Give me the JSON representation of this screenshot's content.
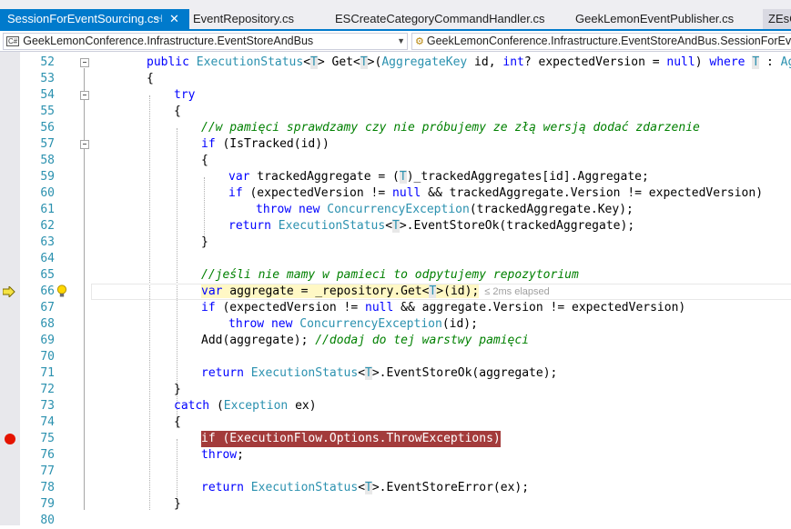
{
  "tabs": [
    {
      "label": "SessionForEventSourcing.cs",
      "active": true,
      "pin": "⊣",
      "close": "✕"
    },
    {
      "label": "EventRepository.cs"
    },
    {
      "label": "ESCreateCategoryCommandHandler.cs"
    },
    {
      "label": "GeekLemonEventPublisher.cs"
    },
    {
      "label": "ZEsC"
    }
  ],
  "navbar": {
    "left_badge": "C#",
    "left": "GeekLemonConference.Infrastructure.EventStoreAndBus",
    "right": "GeekLemonConference.Infrastructure.EventStoreAndBus.SessionForEventSo"
  },
  "execution": {
    "current_line": 66,
    "elapsed": "≤ 2ms elapsed",
    "breakpoint_line": 75
  },
  "colors": {
    "accent": "#007acc",
    "keyword": "#0000ff",
    "type": "#2b91af",
    "comment": "#008000",
    "breakpoint": "#e51400"
  },
  "lines": [
    {
      "n": "52"
    },
    {
      "n": "53"
    },
    {
      "n": "54"
    },
    {
      "n": "55"
    },
    {
      "n": "56"
    },
    {
      "n": "57"
    },
    {
      "n": "58"
    },
    {
      "n": "59"
    },
    {
      "n": "60"
    },
    {
      "n": "61"
    },
    {
      "n": "62"
    },
    {
      "n": "63"
    },
    {
      "n": "64"
    },
    {
      "n": "65"
    },
    {
      "n": "66"
    },
    {
      "n": "67"
    },
    {
      "n": "68"
    },
    {
      "n": "69"
    },
    {
      "n": "70"
    },
    {
      "n": "71"
    },
    {
      "n": "72"
    },
    {
      "n": "73"
    },
    {
      "n": "74"
    },
    {
      "n": "75"
    },
    {
      "n": "76"
    },
    {
      "n": "77"
    },
    {
      "n": "78"
    },
    {
      "n": "79"
    },
    {
      "n": "80"
    }
  ],
  "code": {
    "l52": {
      "a": "public ",
      "b": "ExecutionStatus",
      "c": "<",
      "d": "T",
      "e": "> Get<",
      "f": "T",
      "g": ">(",
      "h": "AggregateKey",
      "i": " id, ",
      "j": "int",
      "k": "? expectedVersion = ",
      "l": "null",
      "m": ") ",
      "n": "where",
      "o": " ",
      "p": "T",
      "q": " : ",
      "r": "Aggre"
    },
    "l53": "{",
    "l54": "try",
    "l55": "{",
    "l56": "//w pamięci sprawdzamy czy nie próbujemy ze złą wersją dodać zdarzenie",
    "l57": {
      "a": "if",
      "b": " (IsTracked(id))"
    },
    "l58": "{",
    "l59": {
      "a": "var",
      "b": " trackedAggregate = (",
      "c": "T",
      "d": ")_trackedAggregates[id].Aggregate;"
    },
    "l60": {
      "a": "if",
      "b": " (expectedVersion != ",
      "c": "null",
      "d": " && trackedAggregate.Version != expectedVersion)"
    },
    "l61": {
      "a": "throw",
      "b": " ",
      "c": "new",
      "d": " ",
      "e": "ConcurrencyException",
      "f": "(trackedAggregate.Key);"
    },
    "l62": {
      "a": "return",
      "b": " ",
      "c": "ExecutionStatus",
      "d": "<",
      "e": "T",
      "f": ">.EventStoreOk(trackedAggregate);"
    },
    "l63": "}",
    "l65": "//jeśli nie mamy w pamieci to odpytujemy repozytorium",
    "l66": {
      "a": "var",
      "b": " aggregate = _repository.Get<",
      "c": "T",
      "d": ">(id);"
    },
    "l67": {
      "a": "if",
      "b": " (expectedVersion != ",
      "c": "null",
      "d": " && aggregate.Version != expectedVersion)"
    },
    "l68": {
      "a": "throw",
      "b": " ",
      "c": "new",
      "d": " ",
      "e": "ConcurrencyException",
      "f": "(id);"
    },
    "l69": {
      "a": "Add(aggregate); ",
      "b": "//dodaj do tej warstwy pamięci"
    },
    "l71": {
      "a": "return",
      "b": " ",
      "c": "ExecutionStatus",
      "d": "<",
      "e": "T",
      "f": ">.EventStoreOk(aggregate);"
    },
    "l72": "}",
    "l73": {
      "a": "catch",
      "b": " (",
      "c": "Exception",
      "d": " ex)"
    },
    "l74": "{",
    "l75": "if (ExecutionFlow.Options.ThrowExceptions)",
    "l76": {
      "a": "throw",
      "b": ";"
    },
    "l78": {
      "a": "return",
      "b": " ",
      "c": "ExecutionStatus",
      "d": "<",
      "e": "T",
      "f": ">.EventStoreError(ex);"
    },
    "l79": "}"
  }
}
